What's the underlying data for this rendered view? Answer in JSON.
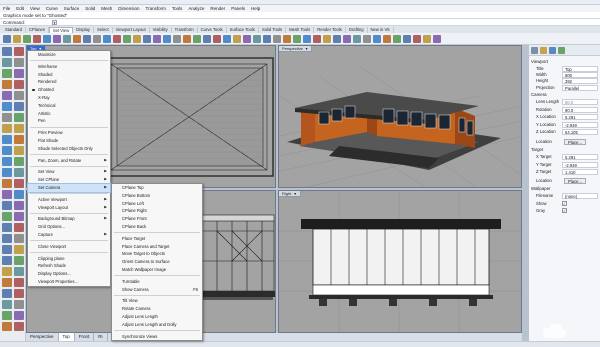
{
  "window": {
    "title": ""
  },
  "menubar": [
    "File",
    "Edit",
    "View",
    "Curve",
    "Surface",
    "Solid",
    "Mesh",
    "Dimension",
    "Transform",
    "Tools",
    "Analyze",
    "Render",
    "Panels",
    "Help"
  ],
  "command": {
    "history": "Graphics mode set to \"Ghosted\"",
    "prompt": "Command:"
  },
  "tabs": [
    {
      "label": "Standard",
      "active": false
    },
    {
      "label": "CPlanes",
      "active": false
    },
    {
      "label": "Set View",
      "active": true
    },
    {
      "label": "Display",
      "active": false
    },
    {
      "label": "Select",
      "active": false
    },
    {
      "label": "Viewport Layout",
      "active": false
    },
    {
      "label": "Visibility",
      "active": false
    },
    {
      "label": "Transform",
      "active": false
    },
    {
      "label": "Curve Tools",
      "active": false
    },
    {
      "label": "Surface Tools",
      "active": false
    },
    {
      "label": "Solid Tools",
      "active": false
    },
    {
      "label": "Mesh Tools",
      "active": false
    },
    {
      "label": "Render Tools",
      "active": false
    },
    {
      "label": "Drafting",
      "active": false
    },
    {
      "label": "New in V5",
      "active": false
    }
  ],
  "viewports": {
    "top": {
      "label": "Top"
    },
    "perspective": {
      "label": "Perspective"
    },
    "front": {
      "label": "Front"
    },
    "right": {
      "label": "Right"
    }
  },
  "viewport_tabs": [
    {
      "label": "Perspective",
      "active": false
    },
    {
      "label": "Top",
      "active": true
    },
    {
      "label": "Front",
      "active": false
    },
    {
      "label": "Ri",
      "active": false
    }
  ],
  "context_menu": {
    "items": [
      {
        "label": "Maximize",
        "type": "item"
      },
      {
        "type": "sep"
      },
      {
        "label": "Wireframe",
        "type": "item"
      },
      {
        "label": "Shaded",
        "type": "item"
      },
      {
        "label": "Rendered",
        "type": "item"
      },
      {
        "label": "Ghosted",
        "type": "item",
        "checked": true
      },
      {
        "label": "X-Ray",
        "type": "item"
      },
      {
        "label": "Technical",
        "type": "item"
      },
      {
        "label": "Artistic",
        "type": "item"
      },
      {
        "label": "Pen",
        "type": "item"
      },
      {
        "type": "sep"
      },
      {
        "label": "Print Preview",
        "type": "item"
      },
      {
        "label": "Flat Shade",
        "type": "item"
      },
      {
        "label": "Shade Selected Objects Only",
        "type": "item"
      },
      {
        "type": "sep"
      },
      {
        "label": "Pan, Zoom, and Rotate",
        "type": "item",
        "submenu": true
      },
      {
        "type": "sep"
      },
      {
        "label": "Set View",
        "type": "item",
        "submenu": true
      },
      {
        "label": "Set CPlane",
        "type": "item",
        "submenu": true
      },
      {
        "label": "Set Camera",
        "type": "item",
        "submenu": true,
        "selected": true
      },
      {
        "type": "sep"
      },
      {
        "label": "Active Viewport",
        "type": "item",
        "submenu": true
      },
      {
        "label": "Viewport Layout",
        "type": "item",
        "submenu": true
      },
      {
        "type": "sep"
      },
      {
        "label": "Background Bitmap",
        "type": "item",
        "submenu": true
      },
      {
        "label": "Grid Options...",
        "type": "item"
      },
      {
        "label": "Capture",
        "type": "item",
        "submenu": true
      },
      {
        "type": "sep"
      },
      {
        "label": "Close Viewport",
        "type": "item"
      },
      {
        "type": "sep"
      },
      {
        "label": "Clipping plane",
        "type": "item"
      },
      {
        "label": "Refresh Shade",
        "type": "item"
      },
      {
        "label": "Display Options...",
        "type": "item"
      },
      {
        "label": "Viewport Properties...",
        "type": "item"
      }
    ]
  },
  "submenu": {
    "items": [
      {
        "label": "CPlane Top",
        "type": "item"
      },
      {
        "label": "CPlane Bottom",
        "type": "item"
      },
      {
        "label": "CPlane Left",
        "type": "item"
      },
      {
        "label": "CPlane Right",
        "type": "item"
      },
      {
        "label": "CPlane Front",
        "type": "item"
      },
      {
        "label": "CPlane Back",
        "type": "item"
      },
      {
        "type": "sep"
      },
      {
        "label": "Place Target",
        "type": "item"
      },
      {
        "label": "Place Camera and Target",
        "type": "item"
      },
      {
        "label": "Move Target to Objects",
        "type": "item"
      },
      {
        "label": "Orient Camera to Surface",
        "type": "item"
      },
      {
        "label": "Match Wallpaper Image",
        "type": "item"
      },
      {
        "type": "sep"
      },
      {
        "label": "Turntable",
        "type": "item"
      },
      {
        "label": "Show Camera",
        "type": "item",
        "shortcut": "F6"
      },
      {
        "type": "sep"
      },
      {
        "label": "Tilt View",
        "type": "item"
      },
      {
        "label": "Rotate Camera",
        "type": "item"
      },
      {
        "label": "Adjust Lens Length",
        "type": "item"
      },
      {
        "label": "Adjust Lens Length and Dolly",
        "type": "item"
      },
      {
        "type": "sep"
      },
      {
        "label": "Synchronize Views",
        "type": "item"
      }
    ]
  },
  "properties": {
    "section_viewport": "Viewport",
    "viewport": [
      {
        "label": "Title",
        "value": "Top"
      },
      {
        "label": "Width",
        "value": "600"
      },
      {
        "label": "Height",
        "value": "392"
      },
      {
        "label": "Projection",
        "value": "Parallel"
      }
    ],
    "section_camera": "Camera",
    "camera": [
      {
        "label": "Lens Length",
        "value": "50.0",
        "gray": true
      },
      {
        "label": "Rotation",
        "value": "90.0"
      },
      {
        "label": "X Location",
        "value": "5.291"
      },
      {
        "label": "Y Location",
        "value": "-2.949"
      },
      {
        "label": "Z Location",
        "value": "54.105"
      }
    ],
    "camera_location_label": "Location",
    "place_button": "Place...",
    "section_target": "Target",
    "target": [
      {
        "label": "X Target",
        "value": "5.291"
      },
      {
        "label": "Y Target",
        "value": "-2.949"
      },
      {
        "label": "Z Target",
        "value": "1.410"
      }
    ],
    "target_location_label": "Location",
    "section_wallpaper": "Wallpaper",
    "wallpaper": [
      {
        "label": "Filename",
        "value": "(none)"
      },
      {
        "label": "Show",
        "checked": true
      },
      {
        "label": "Gray",
        "checked": true
      }
    ]
  },
  "colors": {
    "accent": "#2f6bd0",
    "viewport_bg": "#a3a3a3",
    "menu_highlight": "#cfe3f8",
    "building_wall": "#b5541c",
    "building_roof": "#4a4a4a"
  }
}
